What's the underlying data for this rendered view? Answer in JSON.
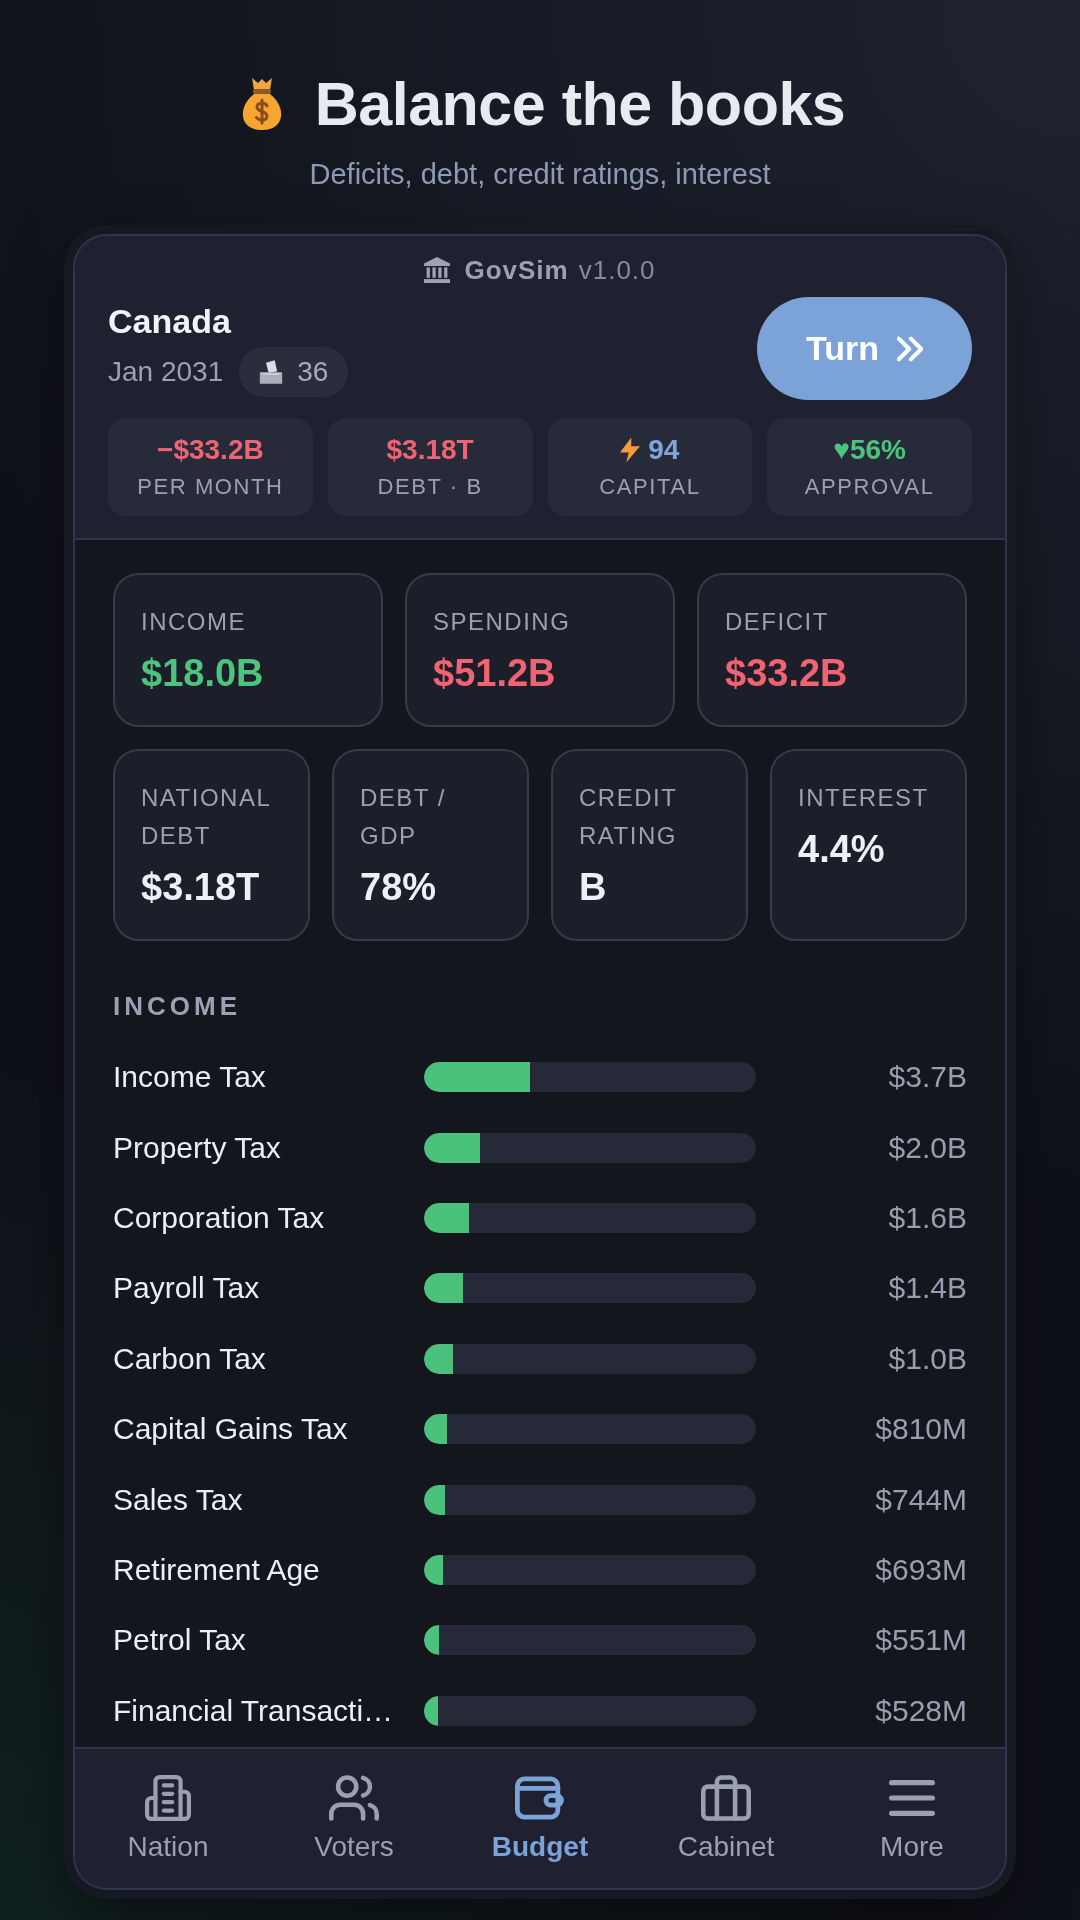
{
  "header": {
    "title": "Balance the books",
    "subtitle": "Deficits, debt, credit ratings, interest"
  },
  "app": {
    "name": "GovSim",
    "version": "v1.0.0"
  },
  "country": {
    "name": "Canada",
    "date": "Jan 2031",
    "counter": "36"
  },
  "turn_button": {
    "label": "Turn"
  },
  "stats": [
    {
      "value": "−$33.2B",
      "label": "PER MONTH",
      "color": "#ef6372",
      "kind": "plain"
    },
    {
      "value": "$3.18T",
      "label": "DEBT · B",
      "color": "#ef6372",
      "kind": "plain"
    },
    {
      "value": "94",
      "label": "CAPITAL",
      "color": "#7ea6dc",
      "kind": "bolt"
    },
    {
      "value": "♥56%",
      "label": "APPROVAL",
      "color": "#4cc47e",
      "kind": "plain"
    }
  ],
  "summary": [
    {
      "cards": [
        {
          "label": "INCOME",
          "value": "$18.0B",
          "color": "#4cc47e"
        },
        {
          "label": "SPENDING",
          "value": "$51.2B",
          "color": "#ef6372"
        },
        {
          "label": "DEFICIT",
          "value": "$33.2B",
          "color": "#ef6372"
        }
      ]
    },
    {
      "cards": [
        {
          "label": "NATIONAL DEBT",
          "value": "$3.18T",
          "color": "#eef0f5"
        },
        {
          "label": "DEBT / GDP",
          "value": "78%",
          "color": "#eef0f5"
        },
        {
          "label": "CREDIT RATING",
          "value": "B",
          "color": "#eef0f5"
        },
        {
          "label": "INTEREST",
          "value": "4.4%",
          "color": "#eef0f5"
        }
      ]
    }
  ],
  "income": {
    "title": "INCOME",
    "items": [
      {
        "name": "Income Tax",
        "level": 0.319,
        "amount": "$3.7B"
      },
      {
        "name": "Property Tax",
        "level": 0.169,
        "amount": "$2.0B"
      },
      {
        "name": "Corporation Tax",
        "level": 0.136,
        "amount": "$1.6B"
      },
      {
        "name": "Payroll Tax",
        "level": 0.117,
        "amount": "$1.4B"
      },
      {
        "name": "Carbon Tax",
        "level": 0.088,
        "amount": "$1.0B"
      },
      {
        "name": "Capital Gains Tax",
        "level": 0.068,
        "amount": "$810M"
      },
      {
        "name": "Sales Tax",
        "level": 0.063,
        "amount": "$744M"
      },
      {
        "name": "Retirement Age",
        "level": 0.058,
        "amount": "$693M"
      },
      {
        "name": "Petrol Tax",
        "level": 0.046,
        "amount": "$551M"
      },
      {
        "name": "Financial Transacti…",
        "level": 0.042,
        "amount": "$528M"
      }
    ]
  },
  "nav": [
    {
      "label": "Nation",
      "selected": false
    },
    {
      "label": "Voters",
      "selected": false
    },
    {
      "label": "Budget",
      "selected": true
    },
    {
      "label": "Cabinet",
      "selected": false
    },
    {
      "label": "More",
      "selected": false
    }
  ]
}
